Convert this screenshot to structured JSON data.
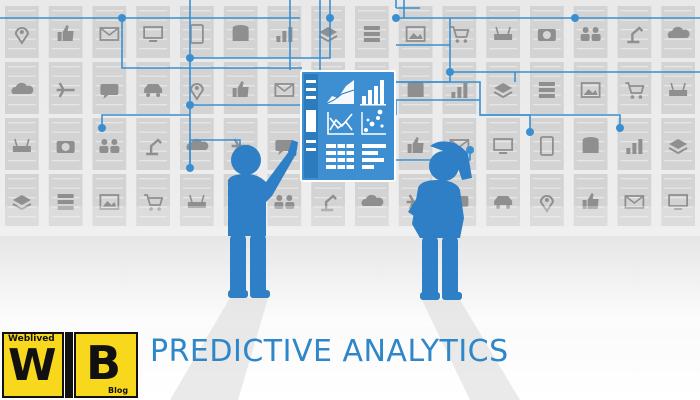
{
  "caption": "PREDICTIVE ANALYTICS",
  "logo": {
    "top_text": "Weblived",
    "letter_left": "W",
    "letter_right": "B",
    "bottom_text": "Blog"
  },
  "colors": {
    "accent_blue": "#2f86c9",
    "line_blue": "#3b8fd0",
    "panel_gray": "#d6d6d6",
    "icon_gray": "#8f8f8f",
    "background_top": "#eeeeee",
    "logo_yellow": "#f7d81c"
  },
  "icons": [
    "map-pin-icon",
    "people-icon",
    "layers-icon",
    "thumbs-up-icon",
    "robot-arm-icon",
    "server-icon",
    "mail-icon",
    "cloud-icon",
    "image-icon",
    "desktop-icon",
    "airplane-icon",
    "cart-icon",
    "tablet-icon",
    "chat-icon",
    "router-icon",
    "database-icon",
    "car-icon",
    "camera-icon",
    "chart-icon"
  ]
}
